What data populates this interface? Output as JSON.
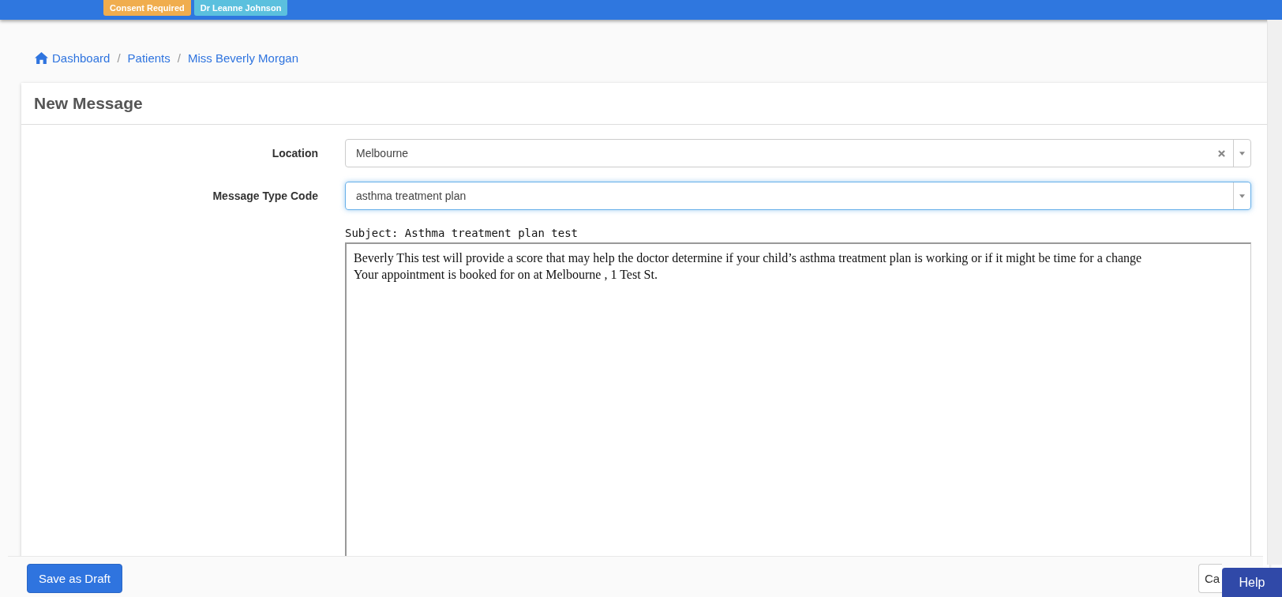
{
  "header": {
    "badges": [
      {
        "label": "Consent Required",
        "color": "#f0ad4e"
      },
      {
        "label": "Dr Leanne Johnson",
        "color": "#5bc0de"
      }
    ]
  },
  "breadcrumb_separator": "/",
  "breadcrumb": [
    {
      "label": "Dashboard",
      "kind": "home"
    },
    {
      "label": "Patients",
      "kind": "link"
    },
    {
      "label": "Miss Beverly Morgan",
      "kind": "link"
    }
  ],
  "card": {
    "title": "New Message",
    "fields": [
      {
        "label": "Location",
        "value": "Melbourne",
        "clearable": true,
        "focused": false
      },
      {
        "label": "Message Type Code",
        "value": "asthma treatment plan",
        "clearable": false,
        "focused": true
      }
    ],
    "subject": "Subject: Asthma treatment plan test",
    "body": [
      "Beverly This test will provide a score that may help the doctor determine if your child’s asthma treatment plan is working or if it might be time for a change",
      "Your appointment is booked for on at Melbourne , 1 Test St."
    ]
  },
  "footer": {
    "save_button": "Save as Draft",
    "cancel_button": "Ca"
  },
  "help_button": "Help"
}
